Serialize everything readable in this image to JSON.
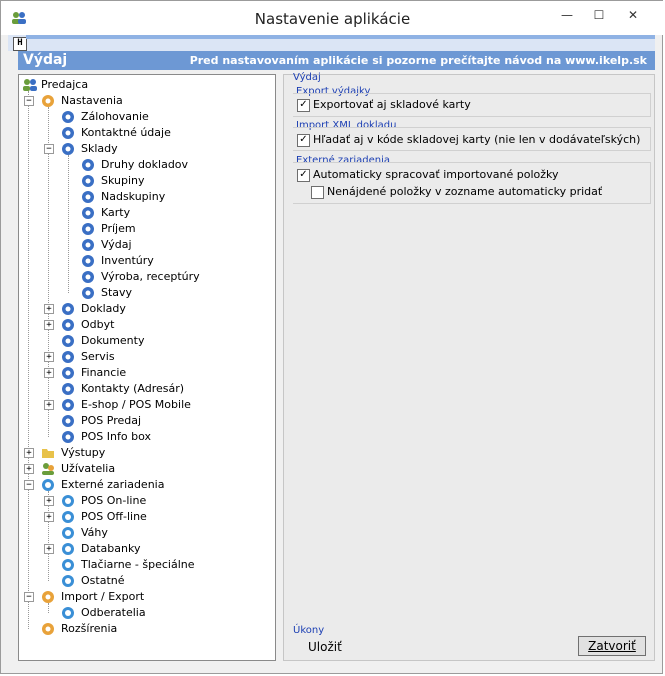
{
  "window": {
    "title": "Nastavenie aplikácie",
    "minimize": "—",
    "maximize": "☐",
    "close": "✕"
  },
  "strip": {
    "toggle": "H"
  },
  "header": {
    "left": "Výdaj",
    "right": "Pred nastavovaním aplikácie si pozorne prečítajte návod na www.ikelp.sk"
  },
  "tree": {
    "root": "Predajca",
    "nastavenia": "Nastavenia",
    "zalohovanie": "Zálohovanie",
    "kontaktne_udaje": "Kontaktné údaje",
    "sklady": "Sklady",
    "druhy_dokladov": "Druhy dokladov",
    "skupiny": "Skupiny",
    "nadskupiny": "Nadskupiny",
    "karty": "Karty",
    "prijem": "Príjem",
    "vydaj": "Výdaj",
    "inventury": "Inventúry",
    "vyroba": "Výroba, receptúry",
    "stavy": "Stavy",
    "doklady": "Doklady",
    "odbyt": "Odbyt",
    "dokumenty": "Dokumenty",
    "servis": "Servis",
    "financie": "Financie",
    "kontakty": "Kontakty (Adresár)",
    "eshop": "E-shop / POS Mobile",
    "pos_predaj": "POS Predaj",
    "pos_info": "POS Info box",
    "vystupy": "Výstupy",
    "uzivatelia": "Užívatelia",
    "externe": "Externé zariadenia",
    "pos_online": "POS On-line",
    "pos_offline": "POS Off-line",
    "vahy": "Váhy",
    "databanky": "Databanky",
    "tlaciarne": "Tlačiarne - špeciálne",
    "ostatne": "Ostatné",
    "import_export": "Import / Export",
    "odberatelia": "Odberatelia",
    "rozsirenia": "Rozšírenia"
  },
  "panel": {
    "title": "Výdaj",
    "export_title": "Export výdajky",
    "export_check": "Exportovať aj skladové karty",
    "import_title": "Import XML dokladu",
    "import_check": "Hľadať aj v kóde skladovej karty (nie len v dodávateľských)",
    "ext_title": "Externé zariadenia",
    "ext_check1": "Automaticky spracovať importované položky",
    "ext_check2": "Nenájdené položky v zozname automaticky pridať",
    "checked_mark": "✓",
    "ukony_title": "Úkony",
    "save": "Uložiť",
    "close": "Zatvoriť"
  },
  "colors": {
    "header_bg": "#6d98d4",
    "section_title": "#1c3fb3",
    "strip_bg": "#dbe5f5"
  },
  "icons": {
    "app": "people-icon",
    "gear": "gear-icon",
    "settings": "settings-icon",
    "folder": "folder-icon",
    "users": "users-icon",
    "device": "device-icon"
  }
}
